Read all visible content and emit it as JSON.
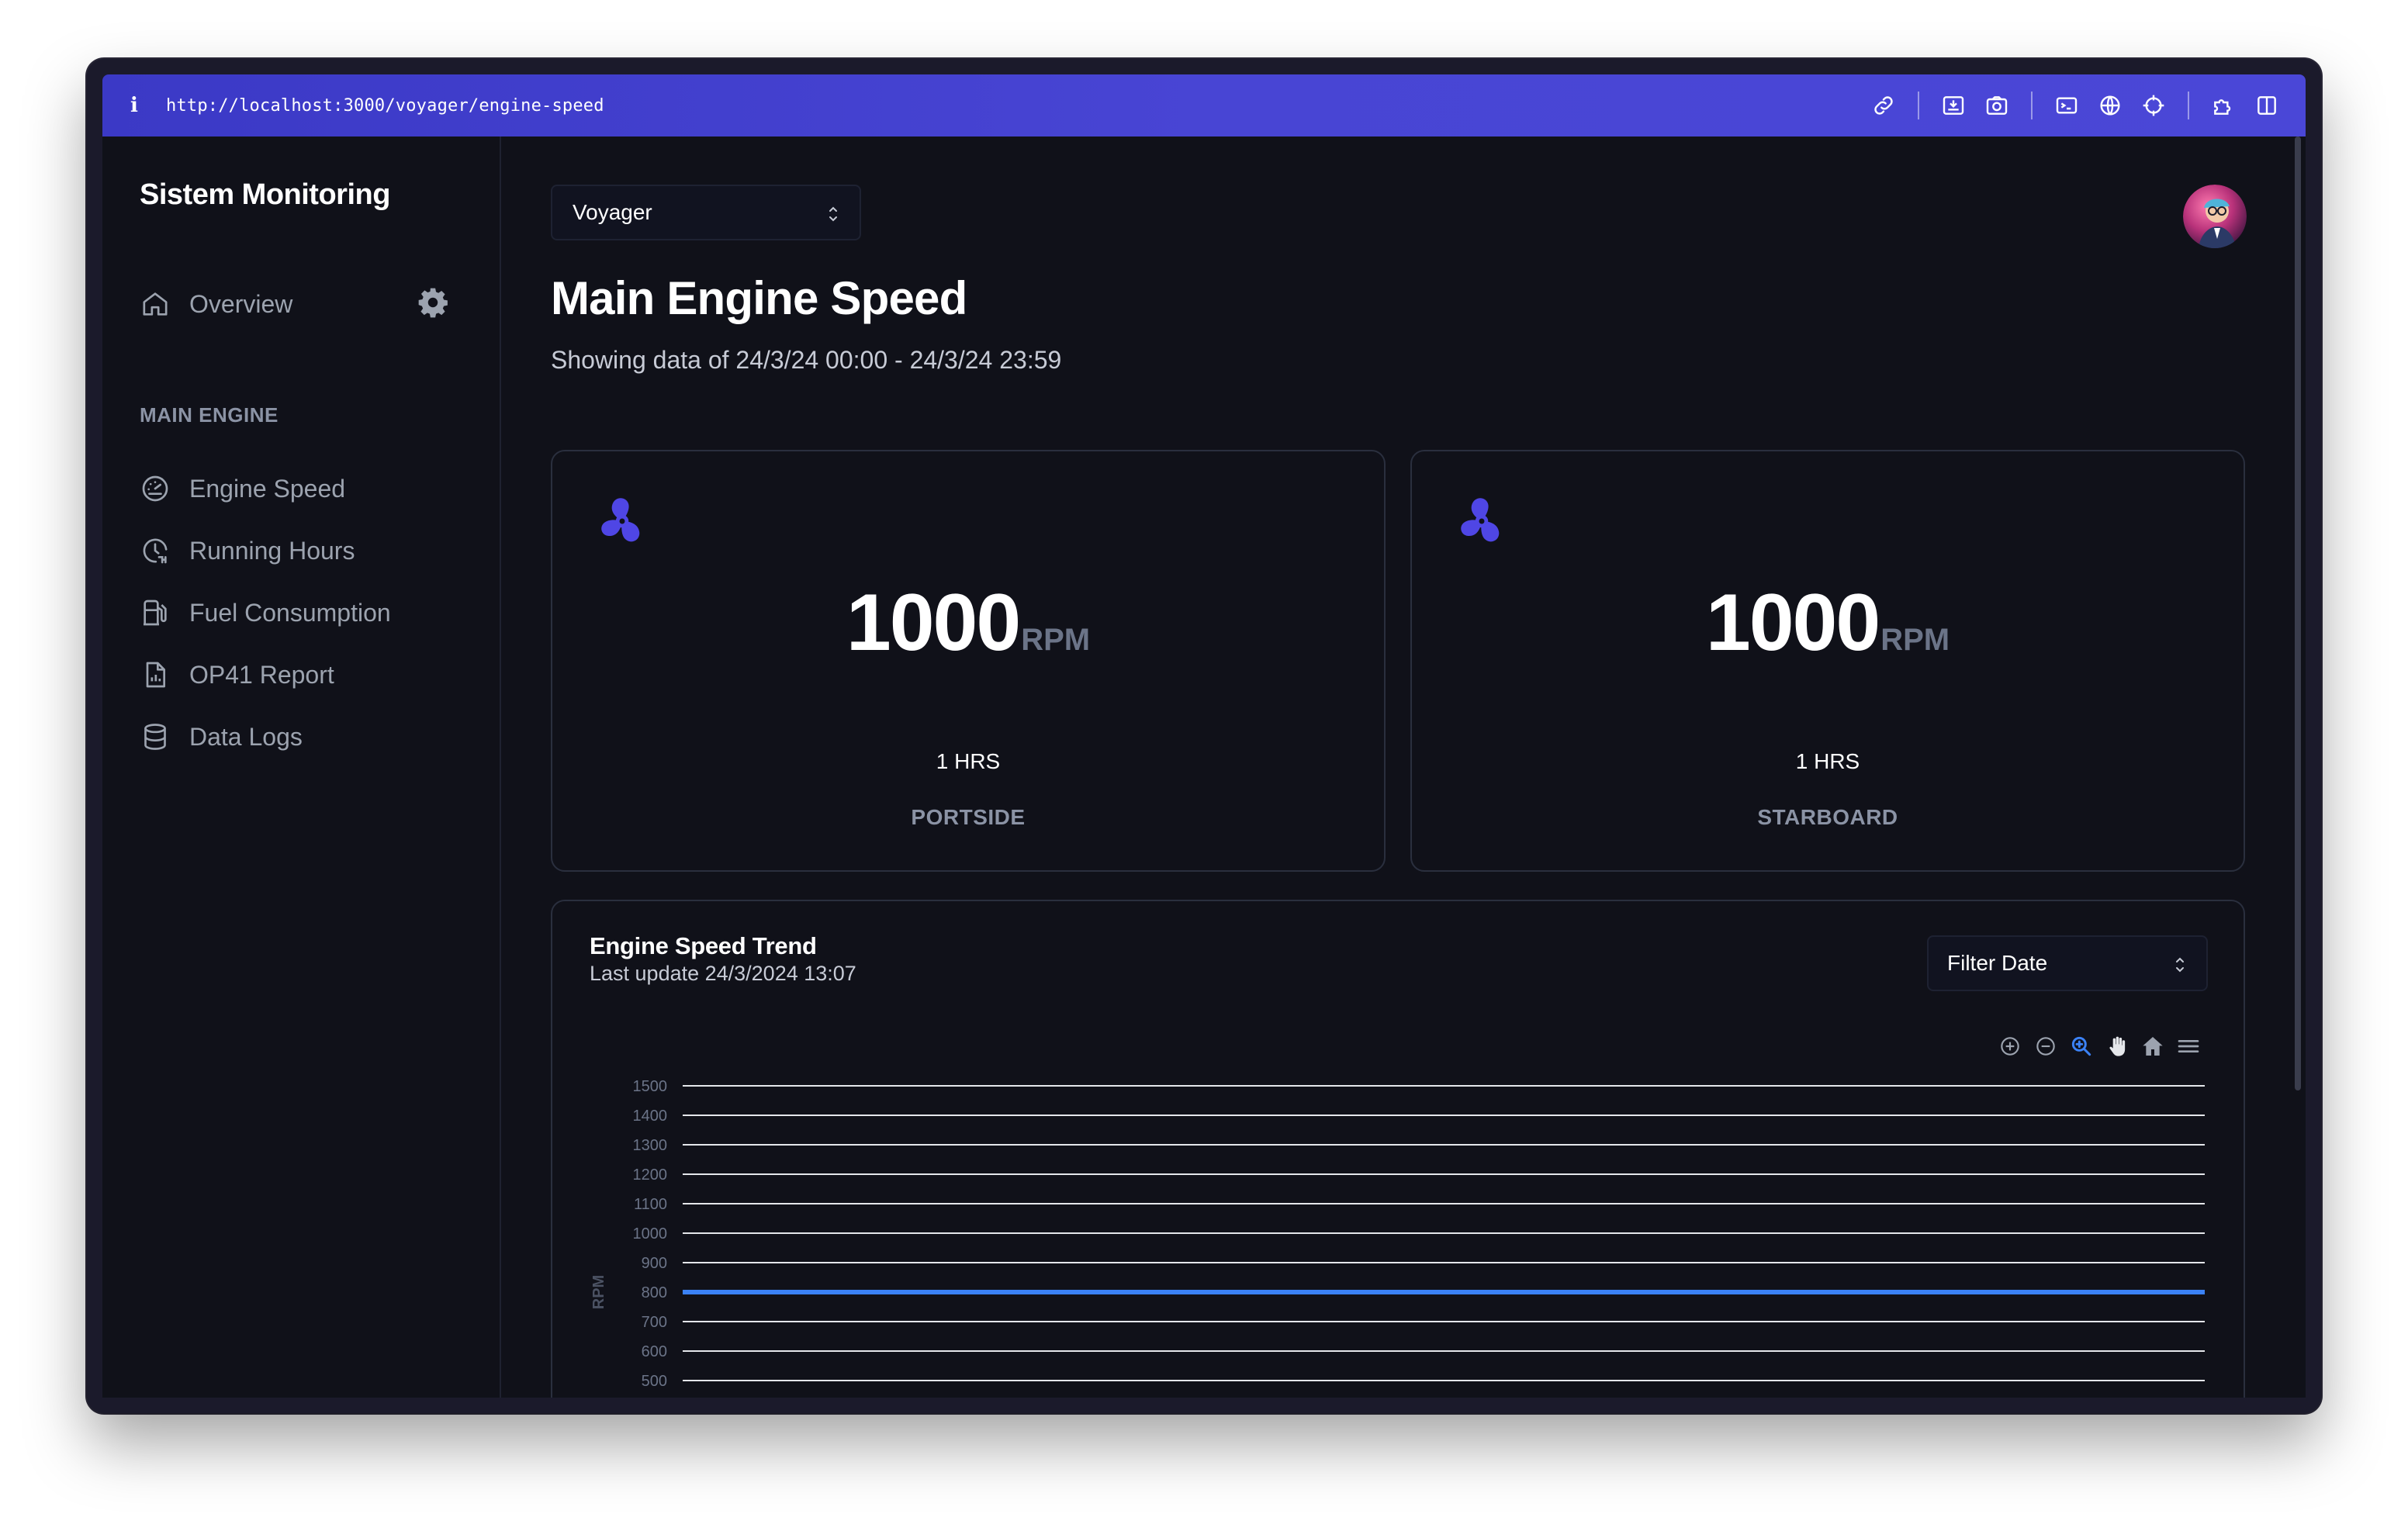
{
  "browser": {
    "info_glyph": "i",
    "url": "http://localhost:3000/voyager/engine-speed",
    "icons": [
      "link-icon",
      "download-icon",
      "camera-icon",
      "terminal-icon",
      "globe-icon",
      "crosshair-icon",
      "extension-icon",
      "split-view-icon"
    ]
  },
  "sidebar": {
    "brand": "Sistem Monitoring",
    "overview_label": "Overview",
    "section_title": "MAIN ENGINE",
    "items": [
      {
        "label": "Engine Speed",
        "icon": "gauge-icon"
      },
      {
        "label": "Running Hours",
        "icon": "clock-history-icon"
      },
      {
        "label": "Fuel Consumption",
        "icon": "fuel-pump-icon"
      },
      {
        "label": "OP41 Report",
        "icon": "report-icon"
      },
      {
        "label": "Data Logs",
        "icon": "database-icon"
      }
    ]
  },
  "header": {
    "vessel_select": "Voyager",
    "title": "Main Engine Speed",
    "subtitle": "Showing data of 24/3/24 00:00 - 24/3/24 23:59"
  },
  "cards": [
    {
      "value": "1000",
      "unit": "RPM",
      "hours": "1 HRS",
      "label": "PORTSIDE"
    },
    {
      "value": "1000",
      "unit": "RPM",
      "hours": "1 HRS",
      "label": "STARBOARD"
    }
  ],
  "trend": {
    "title": "Engine Speed Trend",
    "last_update": "Last update 24/3/2024 13:07",
    "filter_label": "Filter Date",
    "toolbar": [
      "zoom-in-icon",
      "zoom-out-icon",
      "selection-zoom-icon",
      "pan-hand-icon",
      "reset-home-icon",
      "menu-icon"
    ]
  },
  "colors": {
    "accent": "#4f46e5",
    "series": "#3b82f6",
    "background": "#101119"
  },
  "chart_data": {
    "type": "line",
    "ylabel": "RPM",
    "yticks": [
      1500,
      1400,
      1300,
      1200,
      1100,
      1000,
      900,
      800,
      700,
      600,
      500
    ],
    "ylim_visible": [
      500,
      1500
    ],
    "grid": true,
    "series": [
      {
        "values": [
          800,
          800
        ]
      }
    ]
  }
}
